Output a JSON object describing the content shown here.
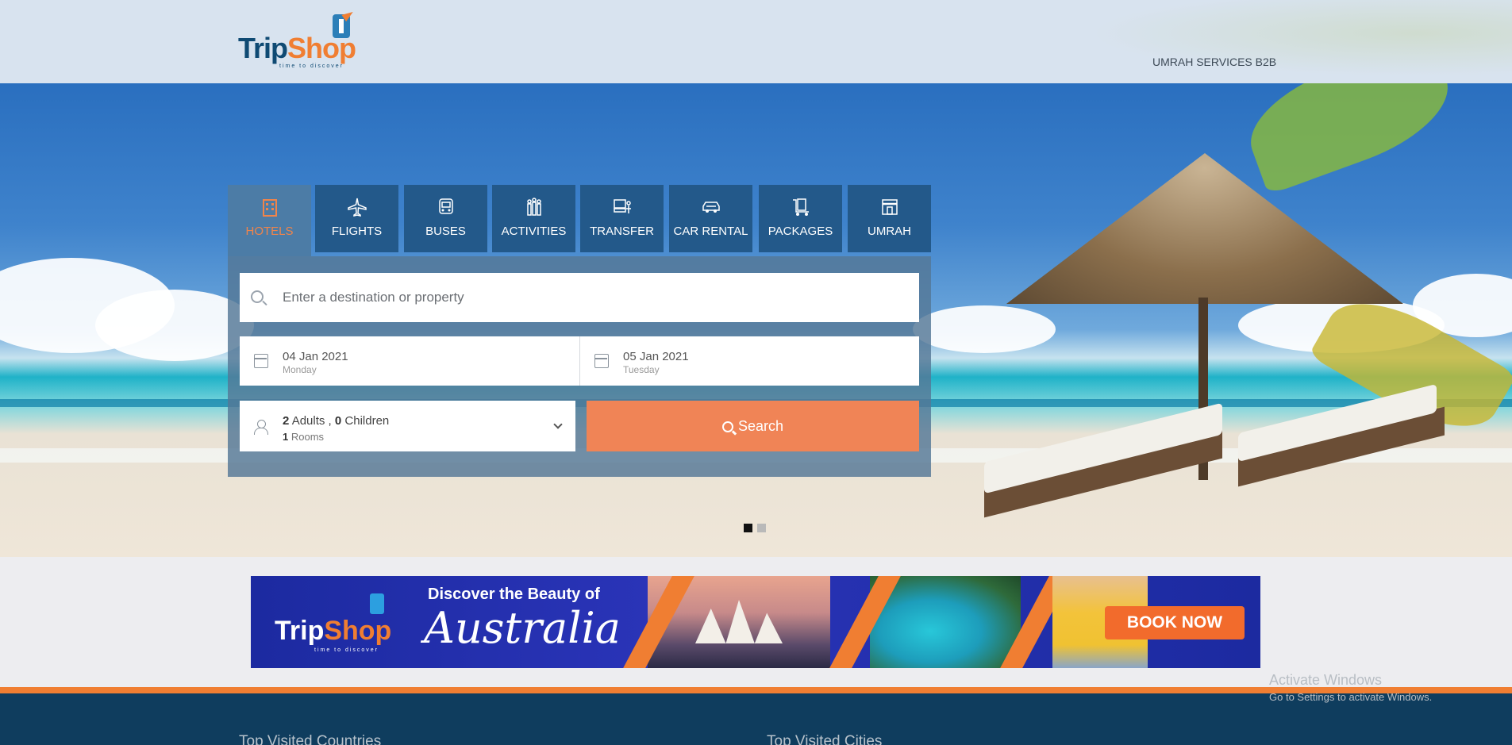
{
  "header": {
    "logo": {
      "brand_part1": "Trip",
      "brand_part2": "Shop",
      "tagline": "time to discover"
    },
    "nav_link": "UMRAH SERVICES B2B"
  },
  "search": {
    "tabs": [
      {
        "label": "HOTELS",
        "icon": "hotel-icon",
        "active": true
      },
      {
        "label": "FLIGHTS",
        "icon": "plane-icon",
        "active": false
      },
      {
        "label": "BUSES",
        "icon": "bus-icon",
        "active": false
      },
      {
        "label": "ACTIVITIES",
        "icon": "activities-icon",
        "active": false
      },
      {
        "label": "TRANSFER",
        "icon": "transfer-icon",
        "active": false
      },
      {
        "label": "CAR RENTAL",
        "icon": "car-icon",
        "active": false
      },
      {
        "label": "PACKAGES",
        "icon": "luggage-cart-icon",
        "active": false
      },
      {
        "label": "UMRAH",
        "icon": "kaaba-icon",
        "active": false
      }
    ],
    "destination_placeholder": "Enter a destination or property",
    "checkin": {
      "date": "04 Jan 2021",
      "day": "Monday"
    },
    "checkout": {
      "date": "05 Jan 2021",
      "day": "Tuesday"
    },
    "guests": {
      "adults": "2",
      "adults_label": "Adults ,",
      "children": "0",
      "children_label": "Children",
      "rooms": "1",
      "rooms_label": "Rooms"
    },
    "button_label": "Search"
  },
  "slider": {
    "dots": 2,
    "active_index": 0
  },
  "banner": {
    "brand_part1": "Trip",
    "brand_part2": "Shop",
    "tagline": "time to discover",
    "headline": "Discover the Beauty of",
    "destination": "Australia",
    "cta": "BOOK NOW"
  },
  "footer": {
    "col1_title": "Top Visited Countries",
    "col2_title": "Top Visited Cities"
  },
  "os_overlay": {
    "title": "Activate Windows",
    "subtitle": "Go to Settings to activate Windows."
  },
  "colors": {
    "accent": "#f07e32",
    "tab_bg": "#23598a",
    "search_button": "#f08456",
    "footer_bg": "#0f3d5e"
  }
}
